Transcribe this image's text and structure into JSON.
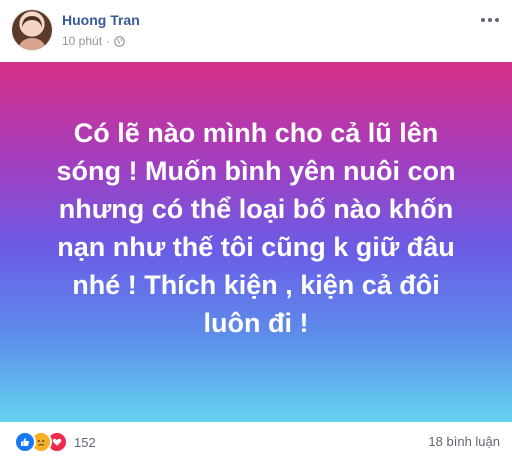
{
  "post": {
    "author": "Huong Tran",
    "time": "10 phút",
    "privacy_icon": "globe-icon",
    "text": "Có lẽ nào mình cho cả lũ lên sóng ! Muốn bình yên nuôi con nhưng có thể loại bố nào khốn nạn như thế tôi cũng k giữ đâu nhé ! Thích kiện , kiện cả đôi luôn đi !",
    "background": {
      "gradient_colors": [
        "#d52f86",
        "#a23ec0",
        "#6b5ce6",
        "#5d8bea",
        "#63d3f0"
      ]
    }
  },
  "footer": {
    "reactions": [
      "like-icon",
      "sad-icon",
      "love-icon"
    ],
    "reaction_count": "152",
    "comments": "18 bình luận"
  },
  "colors": {
    "author": "#385898",
    "meta": "#90949c",
    "like": "#1877f2",
    "sad": "#f7b125",
    "love": "#f0284a"
  }
}
